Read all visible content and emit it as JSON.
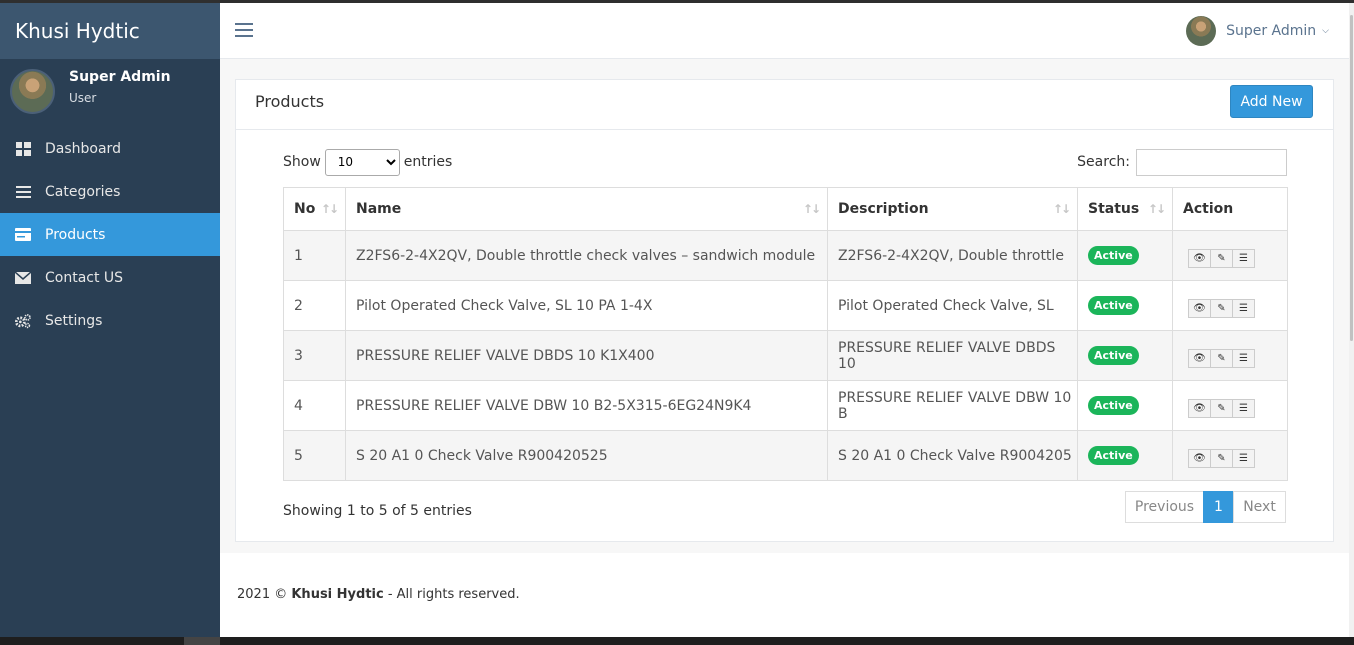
{
  "brand": "Khusi Hydtic",
  "profile": {
    "name": "Super Admin",
    "role": "User"
  },
  "nav": [
    {
      "label": "Dashboard",
      "icon": "dashboard-icon"
    },
    {
      "label": "Categories",
      "icon": "list-icon"
    },
    {
      "label": "Products",
      "icon": "card-icon",
      "active": true
    },
    {
      "label": "Contact US",
      "icon": "envelope-icon"
    },
    {
      "label": "Settings",
      "icon": "gears-icon"
    }
  ],
  "topbar": {
    "user": "Super Admin"
  },
  "panel": {
    "title": "Products",
    "add_label": "Add New"
  },
  "datatable": {
    "show_label": "Show",
    "entries_label": "entries",
    "page_size": "10",
    "search_label": "Search:",
    "search_value": "",
    "columns": [
      "No",
      "Name",
      "Description",
      "Status",
      "Action"
    ],
    "rows": [
      {
        "no": "1",
        "name": "Z2FS6-2-4X2QV, Double throttle check valves – sandwich module",
        "description": "Z2FS6-2-4X2QV, Double throttle",
        "status": "Active"
      },
      {
        "no": "2",
        "name": "Pilot Operated Check Valve, SL 10 PA 1-4X",
        "description": "Pilot Operated Check Valve, SL",
        "status": "Active"
      },
      {
        "no": "3",
        "name": "PRESSURE RELIEF VALVE DBDS 10 K1X400",
        "description": "PRESSURE RELIEF VALVE DBDS 10",
        "status": "Active"
      },
      {
        "no": "4",
        "name": "PRESSURE RELIEF VALVE DBW 10 B2-5X315-6EG24N9K4",
        "description": "PRESSURE RELIEF VALVE DBW 10 B",
        "status": "Active"
      },
      {
        "no": "5",
        "name": "S 20 A1 0 Check Valve R900420525",
        "description": "S 20 A1 0 Check Valve R9004205",
        "status": "Active"
      }
    ],
    "info": "Showing 1 to 5 of 5 entries",
    "pagination": {
      "previous": "Previous",
      "current": "1",
      "next": "Next"
    }
  },
  "footer": {
    "year": "2021 ©",
    "company": "Khusi Hydtic",
    "rights": "- All rights reserved."
  },
  "colors": {
    "sidebar": "#2a3f54",
    "accent": "#3498db",
    "badge": "#1bb55a"
  }
}
